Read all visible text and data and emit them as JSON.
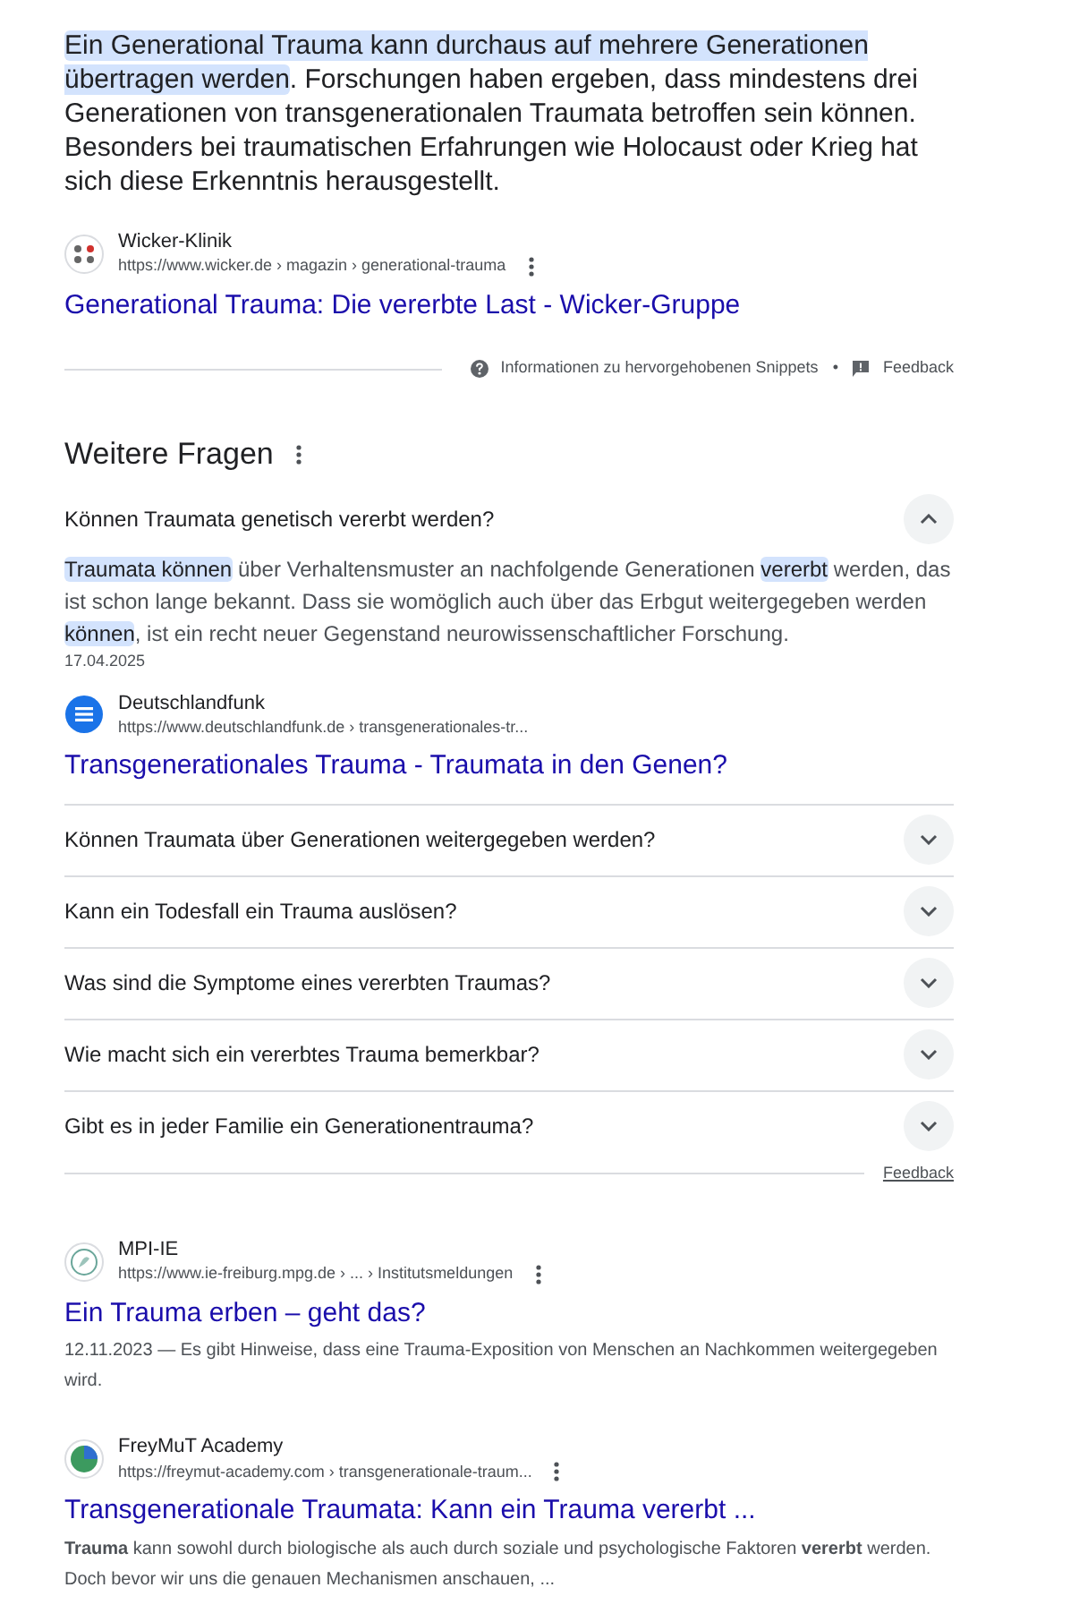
{
  "featured_snippet": {
    "segments": [
      {
        "text": "Ein Generational Trauma kann durchaus auf mehrere Generationen übertragen werden",
        "highlighted": true
      },
      {
        "text": ". Forschungen haben ergeben, dass mindestens drei Generationen von transgenerationalen Traumata betroffen sein können. Besonders bei traumatischen Erfahrungen wie Holocaust oder Krieg hat sich diese Erkenntnis herausgestellt.",
        "highlighted": false
      }
    ],
    "source": {
      "site": "Wicker-Klinik",
      "url": "https://www.wicker.de › magazin › generational-trauma",
      "title": "Generational Trauma: Die vererbte Last - Wicker-Gruppe"
    },
    "footer": {
      "info": "Informationen zu hervorgehobenen Snippets",
      "separator": "•",
      "feedback": "Feedback"
    }
  },
  "related_questions": {
    "heading": "Weitere Fragen",
    "items": [
      {
        "question": "Können Traumata genetisch vererbt werden?",
        "expanded": true,
        "answer": [
          {
            "text": "Traumata können",
            "highlighted": true
          },
          {
            "text": " über Verhaltensmuster an nachfolgende Generationen ",
            "highlighted": false
          },
          {
            "text": "vererbt",
            "highlighted": true
          },
          {
            "text": " werden, das ist schon lange bekannt. Dass sie womöglich auch über das Erbgut weitergegeben werden ",
            "highlighted": false
          },
          {
            "text": "können",
            "highlighted": true
          },
          {
            "text": ", ist ein recht neuer Gegenstand neurowissenschaftlicher Forschung.",
            "highlighted": false
          }
        ],
        "date": "17.04.2025",
        "site": "Deutschlandfunk",
        "url": "https://www.deutschlandfunk.de › transgenerationales-tr...",
        "title": "Transgenerationales Trauma - Traumata in den Genen?"
      },
      {
        "question": "Können Traumata über Generationen weitergegeben werden?",
        "expanded": false
      },
      {
        "question": "Kann ein Todesfall ein Trauma auslösen?",
        "expanded": false
      },
      {
        "question": "Was sind die Symptome eines vererbten Traumas?",
        "expanded": false
      },
      {
        "question": "Wie macht sich ein vererbtes Trauma bemerkbar?",
        "expanded": false
      },
      {
        "question": "Gibt es in jeder Familie ein Generationentrauma?",
        "expanded": false
      }
    ],
    "feedback": "Feedback"
  },
  "results": [
    {
      "kind": "mpi",
      "site": "MPI-IE",
      "url": "https://www.ie-freiburg.mpg.de › ... › Institutsmeldungen",
      "title": "Ein Trauma erben – geht das?",
      "snippet": "12.11.2023 — Es gibt Hinweise, dass eine Trauma-Exposition von Menschen an Nachkommen weitergegeben wird."
    },
    {
      "kind": "freymut",
      "site": "FreyMuT Academy",
      "url": "https://freymut-academy.com › transgenerationale-traum...",
      "title": "Transgenerationale Traumata: Kann ein Trauma vererbt ...",
      "snippet": "**Trauma** kann sowohl durch biologische als auch durch soziale und psychologische Faktoren **vererbt** werden. Doch bevor wir uns die genauen Mechanismen anschauen, ..."
    }
  ]
}
